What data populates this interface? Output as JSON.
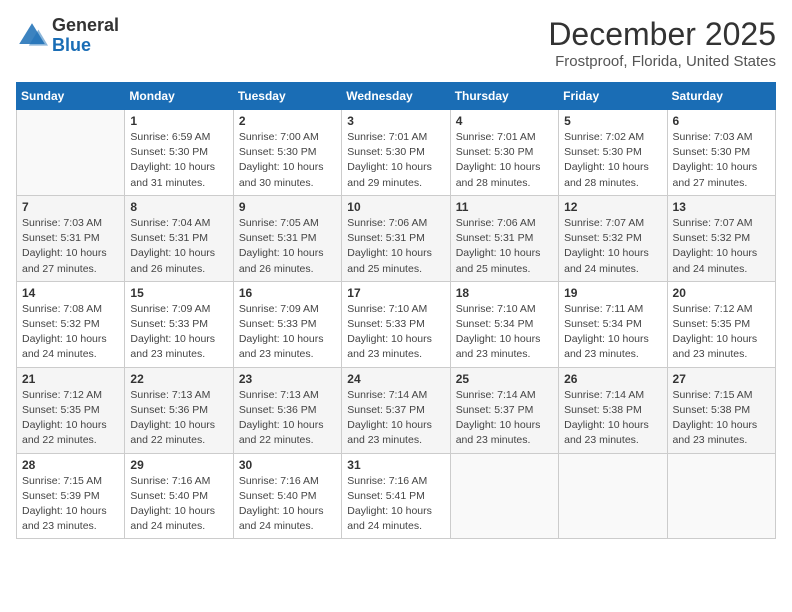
{
  "logo": {
    "general": "General",
    "blue": "Blue"
  },
  "header": {
    "month": "December 2025",
    "location": "Frostproof, Florida, United States"
  },
  "days_of_week": [
    "Sunday",
    "Monday",
    "Tuesday",
    "Wednesday",
    "Thursday",
    "Friday",
    "Saturday"
  ],
  "weeks": [
    [
      {
        "day": "",
        "info": ""
      },
      {
        "day": "1",
        "info": "Sunrise: 6:59 AM\nSunset: 5:30 PM\nDaylight: 10 hours\nand 31 minutes."
      },
      {
        "day": "2",
        "info": "Sunrise: 7:00 AM\nSunset: 5:30 PM\nDaylight: 10 hours\nand 30 minutes."
      },
      {
        "day": "3",
        "info": "Sunrise: 7:01 AM\nSunset: 5:30 PM\nDaylight: 10 hours\nand 29 minutes."
      },
      {
        "day": "4",
        "info": "Sunrise: 7:01 AM\nSunset: 5:30 PM\nDaylight: 10 hours\nand 28 minutes."
      },
      {
        "day": "5",
        "info": "Sunrise: 7:02 AM\nSunset: 5:30 PM\nDaylight: 10 hours\nand 28 minutes."
      },
      {
        "day": "6",
        "info": "Sunrise: 7:03 AM\nSunset: 5:30 PM\nDaylight: 10 hours\nand 27 minutes."
      }
    ],
    [
      {
        "day": "7",
        "info": "Sunrise: 7:03 AM\nSunset: 5:31 PM\nDaylight: 10 hours\nand 27 minutes."
      },
      {
        "day": "8",
        "info": "Sunrise: 7:04 AM\nSunset: 5:31 PM\nDaylight: 10 hours\nand 26 minutes."
      },
      {
        "day": "9",
        "info": "Sunrise: 7:05 AM\nSunset: 5:31 PM\nDaylight: 10 hours\nand 26 minutes."
      },
      {
        "day": "10",
        "info": "Sunrise: 7:06 AM\nSunset: 5:31 PM\nDaylight: 10 hours\nand 25 minutes."
      },
      {
        "day": "11",
        "info": "Sunrise: 7:06 AM\nSunset: 5:31 PM\nDaylight: 10 hours\nand 25 minutes."
      },
      {
        "day": "12",
        "info": "Sunrise: 7:07 AM\nSunset: 5:32 PM\nDaylight: 10 hours\nand 24 minutes."
      },
      {
        "day": "13",
        "info": "Sunrise: 7:07 AM\nSunset: 5:32 PM\nDaylight: 10 hours\nand 24 minutes."
      }
    ],
    [
      {
        "day": "14",
        "info": "Sunrise: 7:08 AM\nSunset: 5:32 PM\nDaylight: 10 hours\nand 24 minutes."
      },
      {
        "day": "15",
        "info": "Sunrise: 7:09 AM\nSunset: 5:33 PM\nDaylight: 10 hours\nand 23 minutes."
      },
      {
        "day": "16",
        "info": "Sunrise: 7:09 AM\nSunset: 5:33 PM\nDaylight: 10 hours\nand 23 minutes."
      },
      {
        "day": "17",
        "info": "Sunrise: 7:10 AM\nSunset: 5:33 PM\nDaylight: 10 hours\nand 23 minutes."
      },
      {
        "day": "18",
        "info": "Sunrise: 7:10 AM\nSunset: 5:34 PM\nDaylight: 10 hours\nand 23 minutes."
      },
      {
        "day": "19",
        "info": "Sunrise: 7:11 AM\nSunset: 5:34 PM\nDaylight: 10 hours\nand 23 minutes."
      },
      {
        "day": "20",
        "info": "Sunrise: 7:12 AM\nSunset: 5:35 PM\nDaylight: 10 hours\nand 23 minutes."
      }
    ],
    [
      {
        "day": "21",
        "info": "Sunrise: 7:12 AM\nSunset: 5:35 PM\nDaylight: 10 hours\nand 22 minutes."
      },
      {
        "day": "22",
        "info": "Sunrise: 7:13 AM\nSunset: 5:36 PM\nDaylight: 10 hours\nand 22 minutes."
      },
      {
        "day": "23",
        "info": "Sunrise: 7:13 AM\nSunset: 5:36 PM\nDaylight: 10 hours\nand 22 minutes."
      },
      {
        "day": "24",
        "info": "Sunrise: 7:14 AM\nSunset: 5:37 PM\nDaylight: 10 hours\nand 23 minutes."
      },
      {
        "day": "25",
        "info": "Sunrise: 7:14 AM\nSunset: 5:37 PM\nDaylight: 10 hours\nand 23 minutes."
      },
      {
        "day": "26",
        "info": "Sunrise: 7:14 AM\nSunset: 5:38 PM\nDaylight: 10 hours\nand 23 minutes."
      },
      {
        "day": "27",
        "info": "Sunrise: 7:15 AM\nSunset: 5:38 PM\nDaylight: 10 hours\nand 23 minutes."
      }
    ],
    [
      {
        "day": "28",
        "info": "Sunrise: 7:15 AM\nSunset: 5:39 PM\nDaylight: 10 hours\nand 23 minutes."
      },
      {
        "day": "29",
        "info": "Sunrise: 7:16 AM\nSunset: 5:40 PM\nDaylight: 10 hours\nand 24 minutes."
      },
      {
        "day": "30",
        "info": "Sunrise: 7:16 AM\nSunset: 5:40 PM\nDaylight: 10 hours\nand 24 minutes."
      },
      {
        "day": "31",
        "info": "Sunrise: 7:16 AM\nSunset: 5:41 PM\nDaylight: 10 hours\nand 24 minutes."
      },
      {
        "day": "",
        "info": ""
      },
      {
        "day": "",
        "info": ""
      },
      {
        "day": "",
        "info": ""
      }
    ]
  ]
}
